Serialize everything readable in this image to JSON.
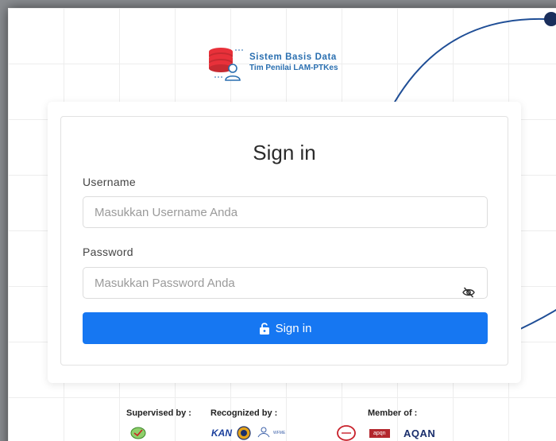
{
  "brand": {
    "line1": "Sistem Basis Data",
    "line2": "Tim Penilai LAM-PTKes",
    "color": "#2a6fb0",
    "logo_color": "#e8313a"
  },
  "form": {
    "title": "Sign in",
    "username_label": "Username",
    "username_placeholder": "Masukkan Username Anda",
    "username_value": "",
    "password_label": "Password",
    "password_placeholder": "Masukkan Password Anda",
    "password_value": "",
    "password_toggle_icon": "eye-slash-icon",
    "submit_label": "Sign in",
    "submit_icon": "unlock-icon",
    "accent_color": "#1677f2"
  },
  "footer": {
    "supervised_label": "Supervised by :",
    "recognized_label": "Recognized by :",
    "member_label": "Member of :",
    "recognized_partners": [
      "KAN",
      "WFME"
    ],
    "member_partners": [
      "apqn",
      "AQAN"
    ]
  }
}
